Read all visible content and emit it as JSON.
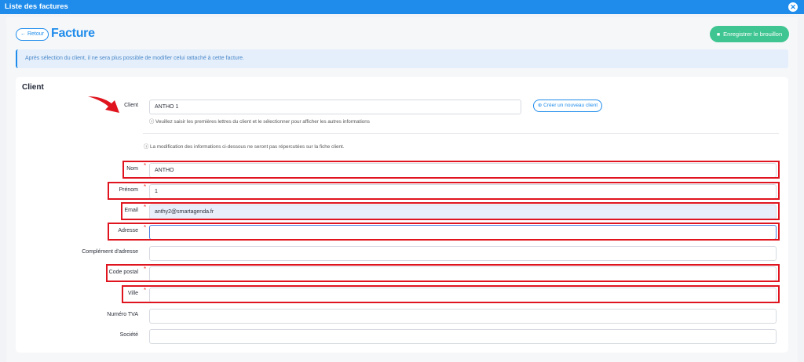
{
  "window": {
    "title": "Liste des factures"
  },
  "header": {
    "back_label": "← Retour",
    "title": "Facture",
    "save_draft_label": "Enregistrer le brouillon"
  },
  "banner": {
    "text": "Après sélection du client, il ne sera plus possible de modifier celui rattaché à cette facture."
  },
  "client_section": {
    "title": "Client",
    "client_label": "Client",
    "client_value": "ANTHO 1",
    "client_hint": "Veuillez saisir les premières lettres du client et le sélectionner pour afficher les autres informations",
    "new_client_label": "Créer un nouveau client",
    "notice": "La modification des informations ci-dessous ne seront pas répercutées sur la fiche client."
  },
  "fields": {
    "nom": {
      "label": "Nom",
      "value": "ANTHO"
    },
    "prenom": {
      "label": "Prénom",
      "value": "1"
    },
    "email": {
      "label": "Email",
      "value": "anthy2@smartagenda.fr"
    },
    "adresse": {
      "label": "Adresse",
      "value": ""
    },
    "complement": {
      "label": "Complément d'adresse",
      "value": ""
    },
    "code_postal": {
      "label": "Code postal",
      "value": ""
    },
    "ville": {
      "label": "Ville",
      "value": ""
    },
    "tva": {
      "label": "Numéro TVA",
      "value": ""
    },
    "societe": {
      "label": "Société",
      "value": ""
    }
  },
  "required_marker": "*",
  "colors": {
    "primary": "#1f8ceb",
    "success": "#3fc591",
    "highlight": "#e0141e"
  },
  "icons": {
    "close": "close-icon",
    "save": "save-icon",
    "info": "info-icon",
    "plus": "plus-circle-icon",
    "arrow": "red-arrow-icon"
  }
}
